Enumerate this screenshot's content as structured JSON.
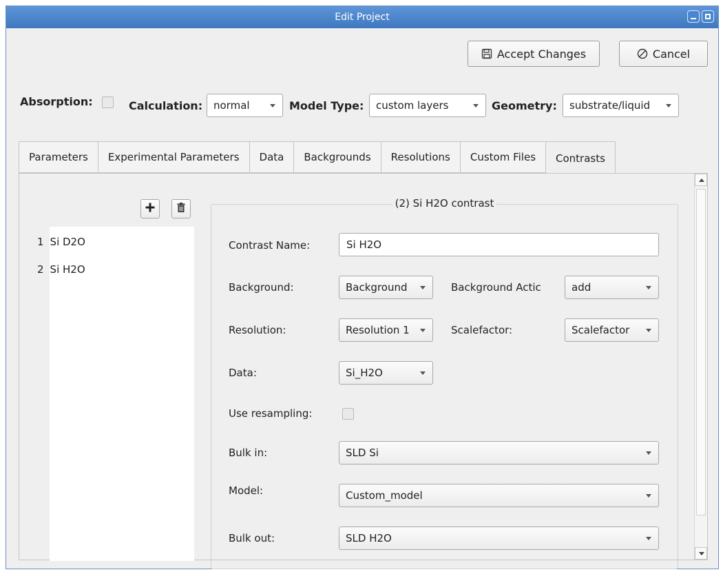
{
  "window": {
    "title": "Edit Project"
  },
  "actions": {
    "accept": "Accept Changes",
    "cancel": "Cancel"
  },
  "settings": {
    "absorption_label": "Absorption:",
    "calculation_label": "Calculation:",
    "calculation_value": "normal",
    "model_type_label": "Model Type:",
    "model_type_value": "custom layers",
    "geometry_label": "Geometry:",
    "geometry_value": "substrate/liquid"
  },
  "tabs": [
    {
      "label": "Parameters"
    },
    {
      "label": "Experimental Parameters"
    },
    {
      "label": "Data"
    },
    {
      "label": "Backgrounds"
    },
    {
      "label": "Resolutions"
    },
    {
      "label": "Custom Files"
    },
    {
      "label": "Contrasts"
    }
  ],
  "contrast_list": [
    {
      "index": "1",
      "name": "Si D2O"
    },
    {
      "index": "2",
      "name": "Si H2O"
    }
  ],
  "contrast_form": {
    "group_title": "(2) Si H2O contrast",
    "name_label": "Contrast Name:",
    "name_value": "Si H2O",
    "background_label": "Background:",
    "background_value": "Background",
    "background_action_label": "Background Actic",
    "background_action_value": "add",
    "resolution_label": "Resolution:",
    "resolution_value": "Resolution 1",
    "scalefactor_label": "Scalefactor:",
    "scalefactor_value": "Scalefactor",
    "data_label": "Data:",
    "data_value": "Si_H2O",
    "resampling_label": "Use resampling:",
    "bulk_in_label": "Bulk in:",
    "bulk_in_value": "SLD Si",
    "model_label": "Model:",
    "model_value": "Custom_model",
    "bulk_out_label": "Bulk out:",
    "bulk_out_value": "SLD H2O"
  }
}
